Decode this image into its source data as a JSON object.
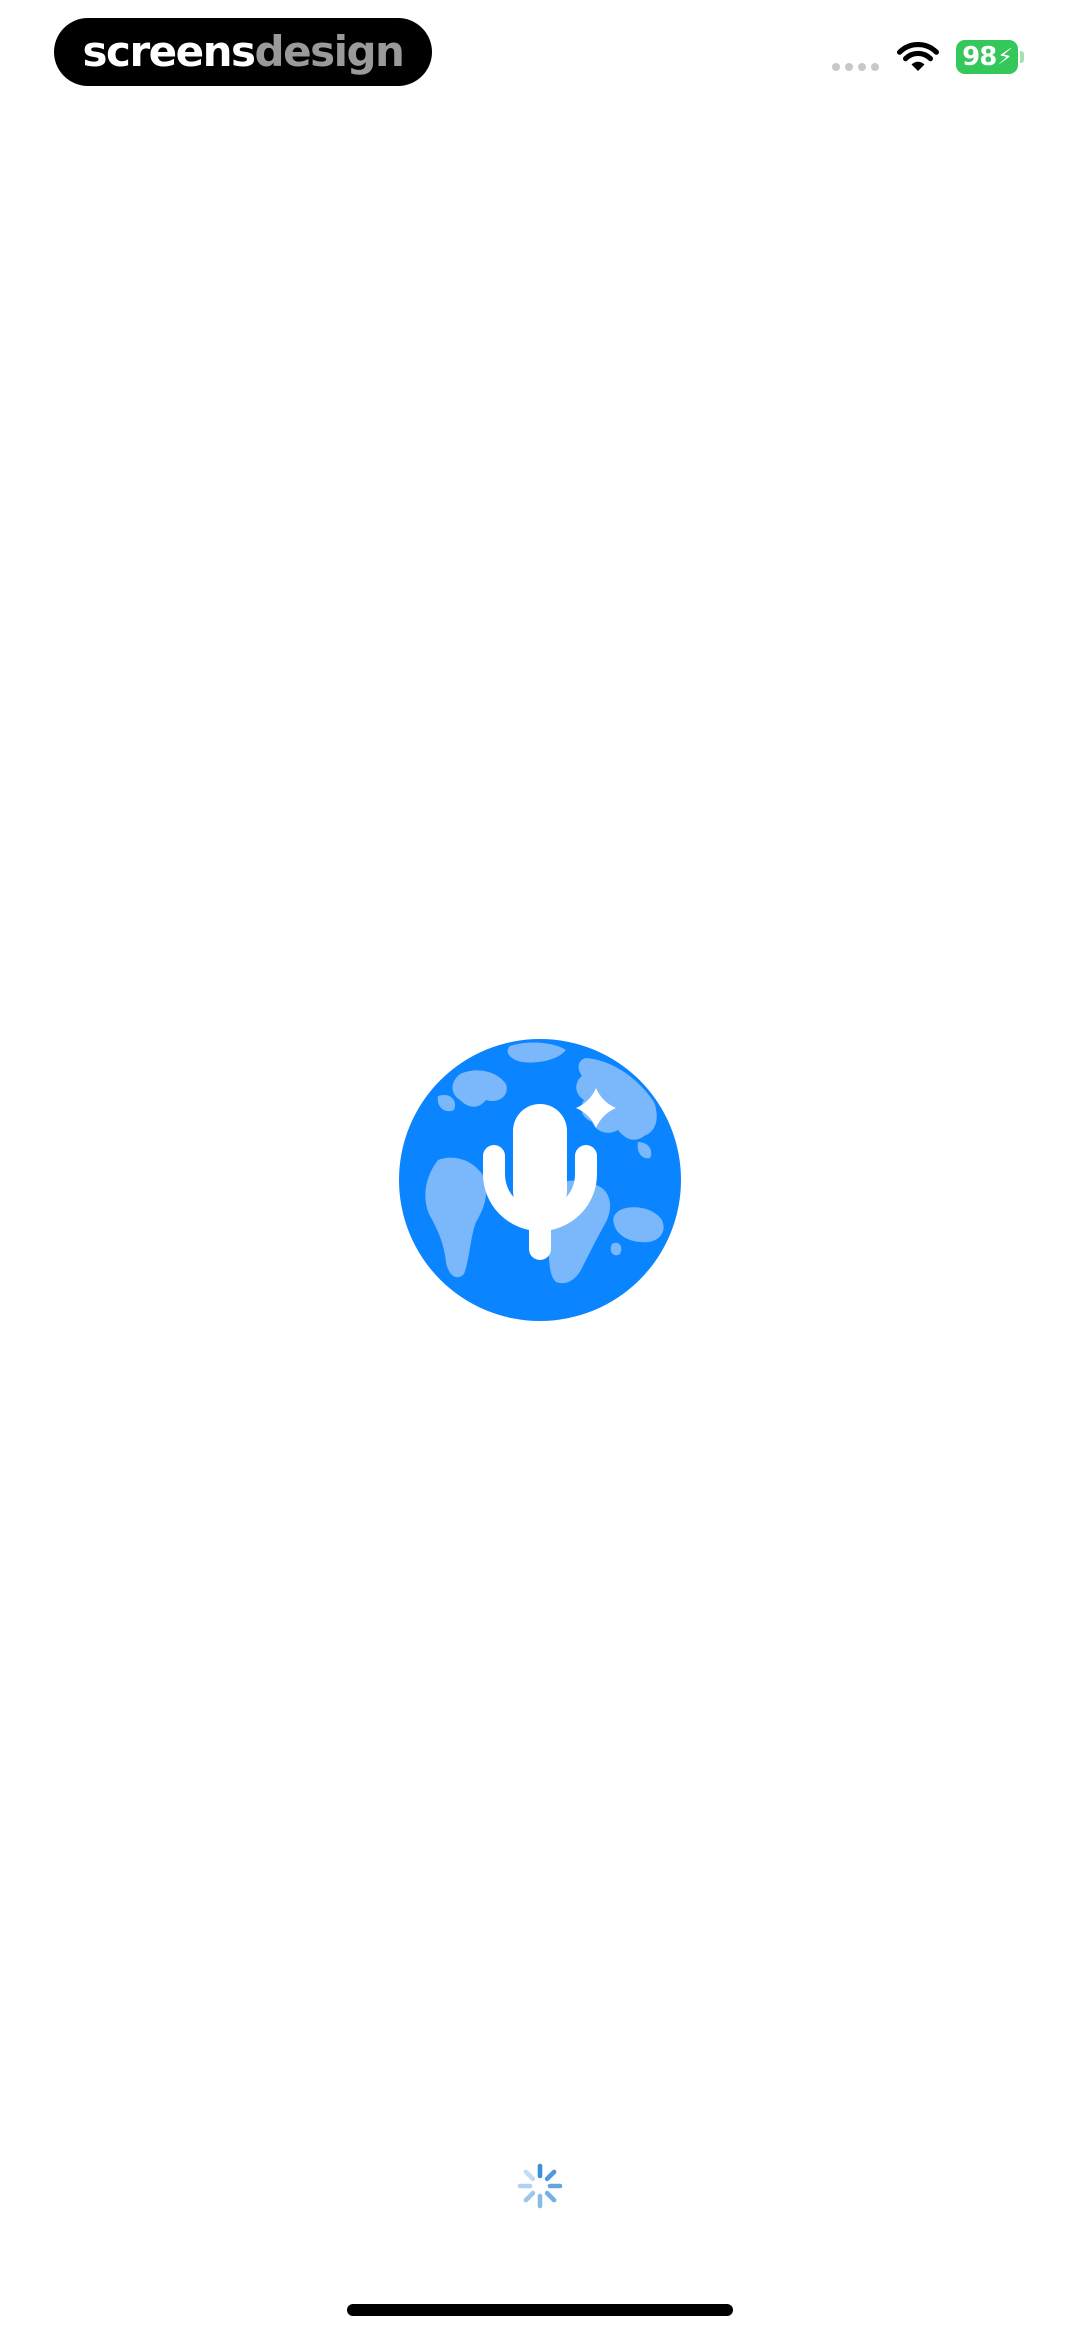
{
  "status_bar": {
    "watermark_part1": "screens",
    "watermark_part2": "design",
    "battery_level": "98",
    "battery_color": "#34c759",
    "wifi_icon": "wifi-icon",
    "signal_icon": "signal-dots-icon"
  },
  "splash": {
    "logo_icon": "globe-microphone-sparkle-icon",
    "logo_primary_color": "#0a84ff",
    "logo_secondary_color": "#7ab8fb",
    "loading_icon": "activity-spinner-icon"
  }
}
